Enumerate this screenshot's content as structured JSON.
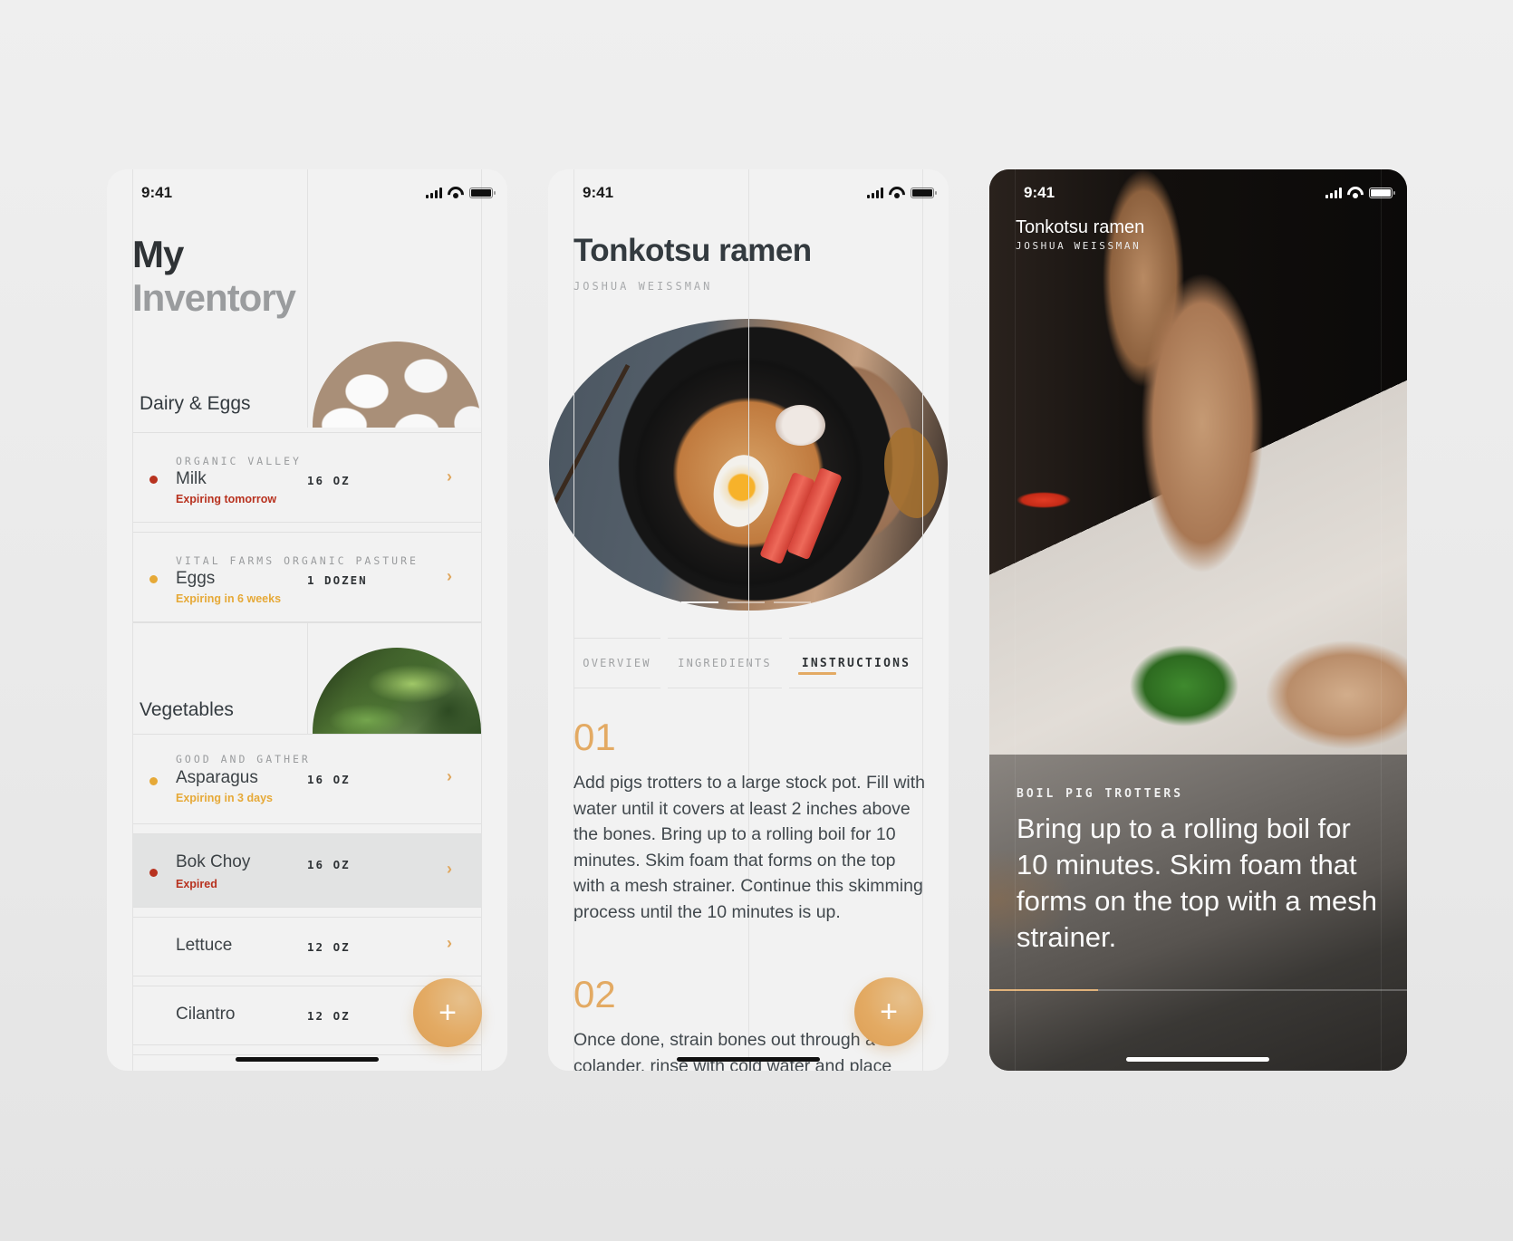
{
  "status_bar": {
    "time": "9:41"
  },
  "inventory": {
    "title_line1": "My",
    "title_line2": "Inventory",
    "sections": [
      {
        "name": "Dairy & Eggs",
        "photo": "eggs-photo",
        "items": [
          {
            "brand": "ORGANIC VALLEY",
            "name": "Milk",
            "quantity": "16 OZ",
            "status": "Expiring tomorrow",
            "status_level": "urgent"
          },
          {
            "brand": "VITAL FARMS ORGANIC PASTURE",
            "name": "Eggs",
            "quantity": "1 DOZEN",
            "status": "Expiring in 6 weeks",
            "status_level": "warning"
          }
        ]
      },
      {
        "name": "Vegetables",
        "photo": "greens-photo",
        "items": [
          {
            "brand": "GOOD AND GATHER",
            "name": "Asparagus",
            "quantity": "16 OZ",
            "status": "Expiring in 3 days",
            "status_level": "warning"
          },
          {
            "brand": "",
            "name": "Bok Choy",
            "quantity": "16 OZ",
            "status": "Expired",
            "status_level": "urgent",
            "selected": true
          },
          {
            "brand": "",
            "name": "Lettuce",
            "quantity": "12 OZ",
            "status": "",
            "status_level": "none"
          },
          {
            "brand": "",
            "name": "Cilantro",
            "quantity": "12 OZ",
            "status": "",
            "status_level": "none"
          }
        ]
      }
    ],
    "add_button_label": "+"
  },
  "recipe": {
    "title": "Tonkotsu ramen",
    "author": "JOSHUA WEISSMAN",
    "carousel": {
      "pages": 3,
      "active_page": 1
    },
    "tabs": [
      {
        "label": "OVERVIEW",
        "active": false
      },
      {
        "label": "INGREDIENTS",
        "active": false
      },
      {
        "label": "INSTRUCTIONS",
        "active": true
      }
    ],
    "steps": [
      {
        "number": "01",
        "text": "Add pigs trotters to a large stock pot. Fill with water until it covers at least 2 inches above the bones. Bring up to a rolling boil for 10 minutes. Skim foam that forms on the top with a mesh strainer. Continue this skimming process until the 10 minutes is up."
      },
      {
        "number": "02",
        "text": "Once done, strain bones out through a colander, rinse with cold water and place"
      }
    ],
    "add_button_label": "+"
  },
  "cook_mode": {
    "title": "Tonkotsu ramen",
    "author": "JOSHUA WEISSMAN",
    "step_label": "BOIL PIG TROTTERS",
    "step_text": "Bring up to a rolling boil for 10 minutes. Skim foam that forms on the top with a mesh strainer.",
    "progress_percent": 26
  },
  "colors": {
    "accent": "#e3aa63",
    "urgent": "#b8321f",
    "warning": "#e6a937",
    "text_primary": "#333a3f",
    "text_muted": "#9a9c9e"
  }
}
